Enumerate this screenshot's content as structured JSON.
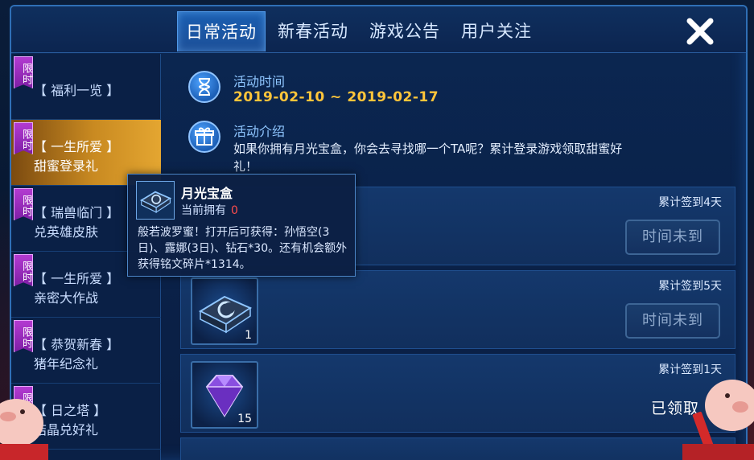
{
  "tabs": [
    {
      "label": "日常活动",
      "active": true
    },
    {
      "label": "新春活动",
      "active": false
    },
    {
      "label": "游戏公告",
      "active": false
    },
    {
      "label": "用户关注",
      "active": false
    }
  ],
  "close_icon": "close-icon",
  "sidebar": {
    "badge_label": "限时",
    "items": [
      {
        "line1": "【 福利一览 】",
        "line2": "",
        "active": false
      },
      {
        "line1": "【 一生所爱 】",
        "line2": "甜蜜登录礼",
        "active": true
      },
      {
        "line1": "【 瑞兽临门 】",
        "line2": "兑英雄皮肤",
        "active": false
      },
      {
        "line1": "【 一生所爱 】",
        "line2": "亲密大作战",
        "active": false
      },
      {
        "line1": "【 恭贺新春 】",
        "line2": "猪年纪念礼",
        "active": false
      },
      {
        "line1": "【 日之塔 】",
        "line2": "结晶兑好礼",
        "active": false
      }
    ]
  },
  "activity": {
    "time_label": "活动时间",
    "time_value": "2019-02-10 ~ 2019-02-17",
    "intro_label": "活动介绍",
    "intro_text": "如果你拥有月光宝盒，你会去寻找哪一个TA呢？累计登录游戏领取甜蜜好礼！",
    "time_icon": "hourglass-icon",
    "intro_icon": "gift-icon"
  },
  "rewards": [
    {
      "condition": "累计签到4天",
      "item_icon": "",
      "count": "",
      "status": "时间未到"
    },
    {
      "condition": "累计签到5天",
      "item_icon": "moonlight-box-icon",
      "count": "1",
      "status": "时间未到"
    },
    {
      "condition": "累计签到1天",
      "item_icon": "purple-crystal-icon",
      "count": "15",
      "status": "已领取"
    }
  ],
  "tooltip": {
    "name": "月光宝盒",
    "own_label": "当前拥有",
    "own_value": "0",
    "description": "般若波罗蜜！打开后可获得：孙悟空(3日)、露娜(3日)、钻石*30。还有机会额外获得铭文碎片*1314。"
  },
  "colors": {
    "accent_gold": "#ffc53a",
    "active_tab": "#1a5fb2",
    "badge_purple": "#b33bd1",
    "owned_zero": "#ff4d4d"
  }
}
